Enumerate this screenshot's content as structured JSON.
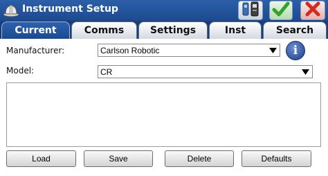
{
  "window": {
    "title": "Instrument Setup",
    "icons": {
      "app": "hardhat-icon",
      "instrument": "instrument-icon",
      "ok": "checkmark-icon",
      "close": "close-icon"
    }
  },
  "tabs": [
    {
      "label": "Current",
      "active": true
    },
    {
      "label": "Comms",
      "active": false
    },
    {
      "label": "Settings",
      "active": false
    },
    {
      "label": "Inst",
      "active": false
    },
    {
      "label": "Search",
      "active": false
    }
  ],
  "form": {
    "manufacturer_label": "Manufacturer:",
    "manufacturer_value": "Carlson Robotic",
    "model_label": "Model:",
    "model_value": "CR",
    "info_icon": "info-icon",
    "info_glyph": "i"
  },
  "buttons": {
    "load": "Load",
    "save": "Save",
    "delete": "Delete",
    "defaults": "Defaults"
  },
  "colors": {
    "titlebar": "#1c4a90",
    "active_tab": "#1a4a93",
    "ok_green": "#2fa52c",
    "close_red": "#d42a1e"
  }
}
